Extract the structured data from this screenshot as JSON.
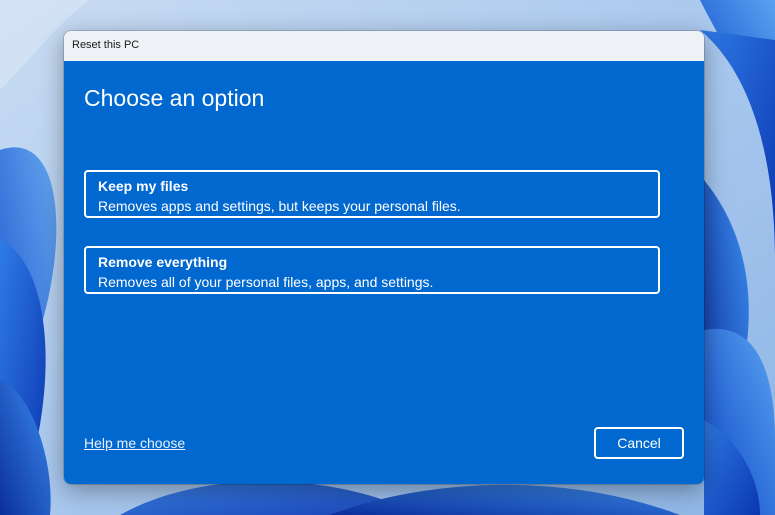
{
  "window": {
    "title": "Reset this PC"
  },
  "dialog": {
    "heading": "Choose an option",
    "options": [
      {
        "title": "Keep my files",
        "description": "Removes apps and settings, but keeps your personal files."
      },
      {
        "title": "Remove everything",
        "description": "Removes all of your personal files, apps, and settings."
      }
    ],
    "help_link": "Help me choose",
    "cancel_label": "Cancel"
  },
  "colors": {
    "dialog_background": "#0168d0",
    "titlebar_background": "#eef2f7",
    "text": "#ffffff",
    "wallpaper_dark": "#0a3fb8",
    "wallpaper_light": "#9fc3ea"
  }
}
